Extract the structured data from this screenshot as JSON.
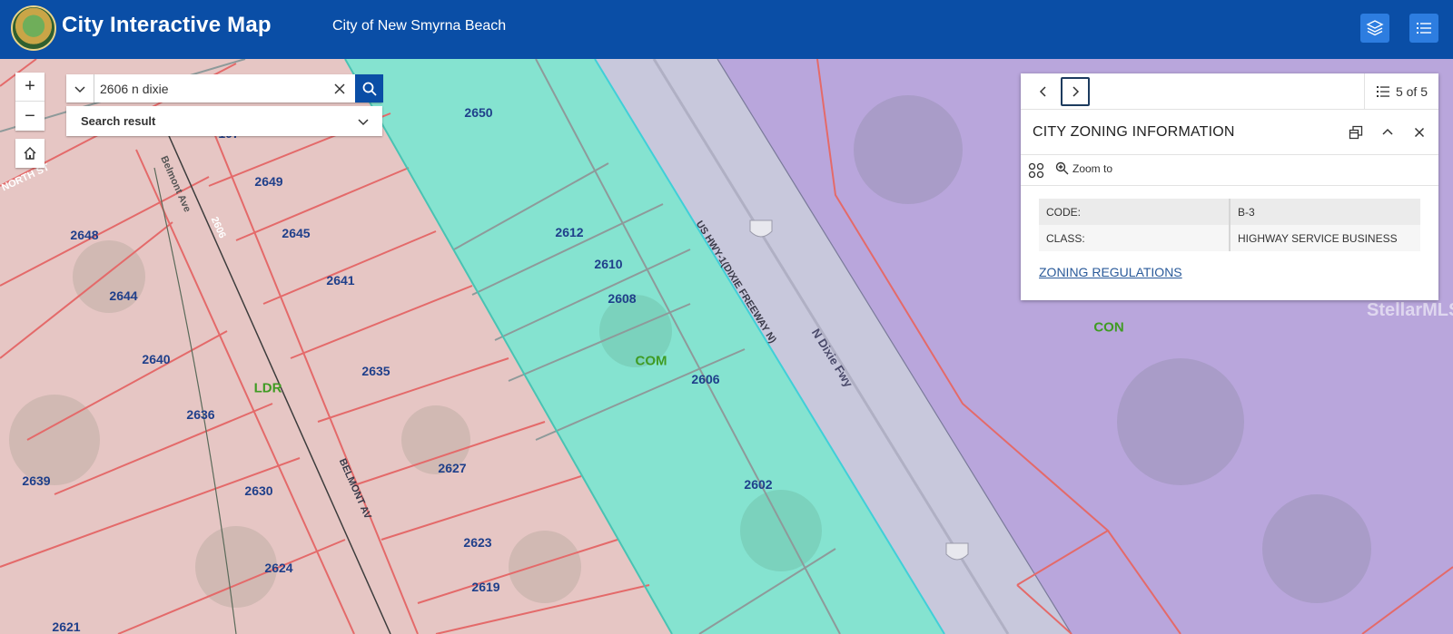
{
  "header": {
    "app_title": "City Interactive Map",
    "subtitle": "City of New Smyrna Beach",
    "bg_color": "#0a4ea6",
    "buttons": [
      {
        "name": "layers-button",
        "icon": "layers-icon"
      },
      {
        "name": "legend-button",
        "icon": "list-icon"
      }
    ]
  },
  "map_controls": {
    "zoom_in": "+",
    "zoom_out": "−",
    "home_icon": "home-icon"
  },
  "search": {
    "value": "2606 n dixie",
    "result_label": "Search result"
  },
  "popup": {
    "pager": "5 of 5",
    "title": "CITY ZONING INFORMATION",
    "zoom_to": "Zoom to",
    "attributes": [
      {
        "key": "CODE:",
        "value": "B-3"
      },
      {
        "key": "CLASS:",
        "value": "HIGHWAY SERVICE BUSINESS"
      }
    ],
    "link": "ZONING REGULATIONS"
  },
  "map": {
    "parcels": [
      "2650",
      "2649",
      "2648",
      "2645",
      "2641",
      "2644",
      "2640",
      "2635",
      "2636",
      "2639",
      "2630",
      "2627",
      "2624",
      "2623",
      "2619",
      "2612",
      "2610",
      "2608",
      "2606",
      "2602",
      "107",
      "2621"
    ],
    "zones": [
      "LDR",
      "COM",
      "CON"
    ],
    "roads": [
      "US HWY-1(DIXIE FREEWAY N)",
      "N Dixie Fwy",
      "BELMONT AV",
      "Belmont Ave",
      "NORTH ST",
      "2606"
    ],
    "watermark": "StellarMLS",
    "zone_colors": {
      "ldr": "#e8c2c0",
      "com": "#7fe3cf",
      "con": "#b8a5dc",
      "parcel_line": "#e46a6a"
    }
  }
}
